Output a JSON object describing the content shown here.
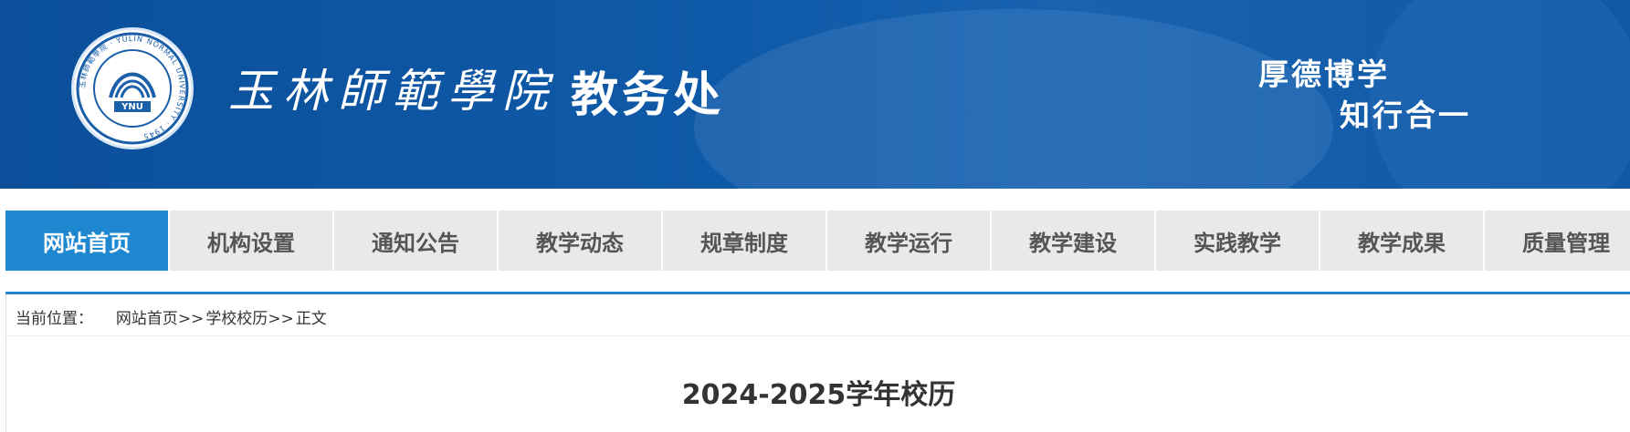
{
  "header": {
    "school_name": "玉林師範學院",
    "dept_name": "教务处",
    "motto_line1": "厚德博学",
    "motto_line2": "知行合一",
    "logo": {
      "icon": "university-seal-logo",
      "ring_text": "玉林師範學院 · YULIN NORMAL UNIVERSITY · 1945",
      "initials": "YNU"
    }
  },
  "nav": {
    "items": [
      {
        "label": "网站首页",
        "active": true
      },
      {
        "label": "机构设置",
        "active": false
      },
      {
        "label": "通知公告",
        "active": false
      },
      {
        "label": "教学动态",
        "active": false
      },
      {
        "label": "规章制度",
        "active": false
      },
      {
        "label": "教学运行",
        "active": false
      },
      {
        "label": "教学建设",
        "active": false
      },
      {
        "label": "实践教学",
        "active": false
      },
      {
        "label": "教学成果",
        "active": false
      },
      {
        "label": "质量管理",
        "active": false
      }
    ]
  },
  "breadcrumb": {
    "prefix": "当前位置：",
    "home": "网站首页",
    "sep1": ">>",
    "section": "学校校历",
    "sep2": ">>",
    "current": "正文"
  },
  "article": {
    "title": "2024-2025学年校历"
  },
  "colors": {
    "banner": "#0f5aa8",
    "nav_active": "#1e87d0",
    "nav_inactive": "#e9e9e9",
    "text": "#333333"
  }
}
